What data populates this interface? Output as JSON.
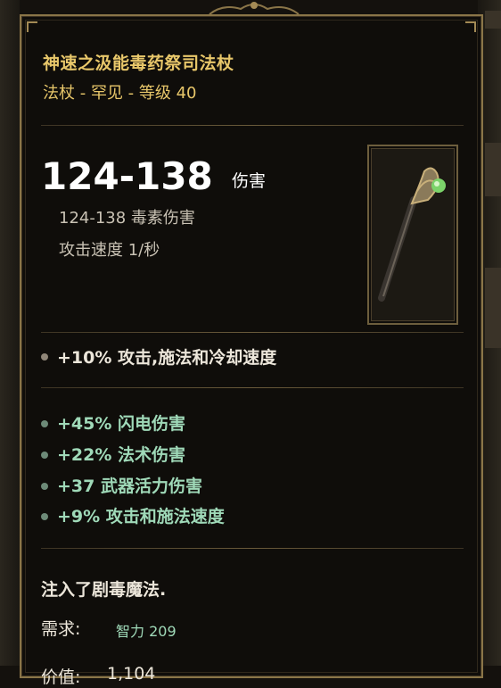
{
  "item": {
    "name": "神速之汲能毒药祭司法杖",
    "subtitle": "法杖 - 罕见 - 等级 40",
    "damage_range": "124-138",
    "damage_label": "伤害",
    "damage_type_line": "124-138 毒素伤害",
    "attack_speed_line": "攻击速度 1/秒",
    "image_icon": "staff-icon"
  },
  "implicit_stats": [
    "+10% 攻击,施法和冷却速度"
  ],
  "affix_stats": [
    "+45% 闪电伤害",
    "+22% 法术伤害",
    "+37 武器活力伤害",
    "+9% 攻击和施法速度"
  ],
  "lore": "注入了剧毒魔法.",
  "requirement": {
    "label": "需求:",
    "value": "智力 209"
  },
  "value": {
    "label": "价值:",
    "amount": "1,104"
  },
  "colors": {
    "name": "#e8c76a",
    "affix_stat": "#9fd9b8",
    "implicit_stat": "#ece6da",
    "border": "#8a7548",
    "background": "#0f0d0a"
  }
}
